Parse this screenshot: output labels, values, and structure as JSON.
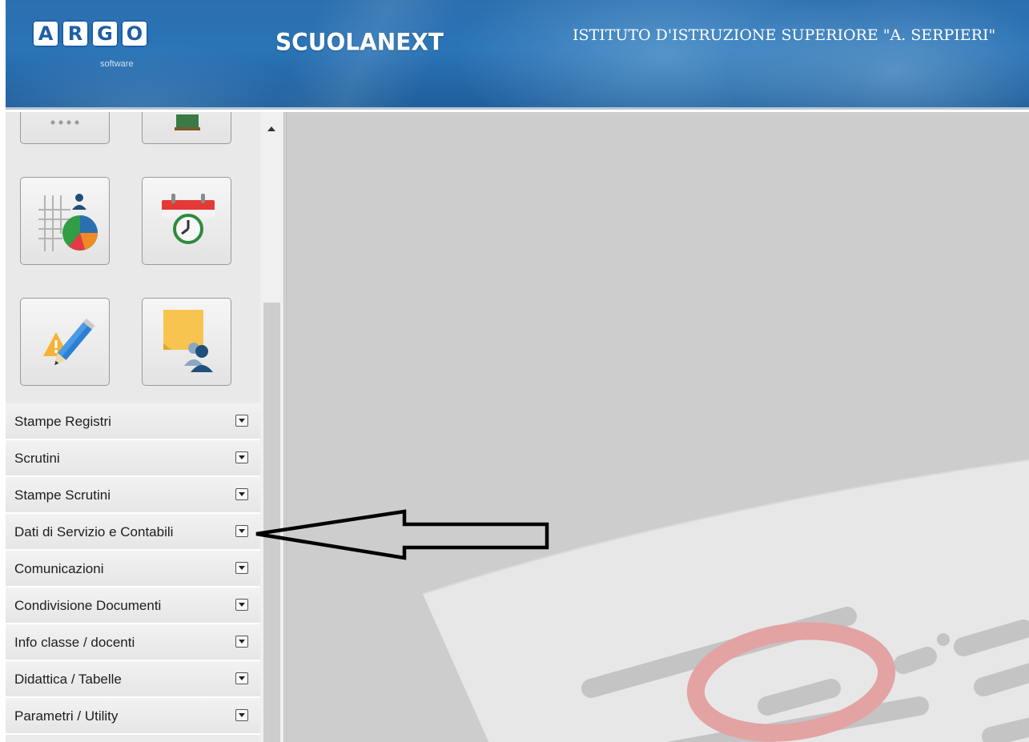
{
  "header": {
    "logo_letters": [
      "A",
      "R",
      "G",
      "O"
    ],
    "logo_subtitle": "software",
    "app_name": "SCUOLANEXT",
    "school_name": "ISTITUTO D'ISTRUZIONE SUPERIORE \"A. SERPIERI\""
  },
  "sidebar": {
    "icon_tiles": [
      {
        "icon": "grid-icon-partial"
      },
      {
        "icon": "board-icon-partial"
      },
      {
        "icon": "statistics-pie-chart-icon"
      },
      {
        "icon": "calendar-clock-icon"
      },
      {
        "icon": "warning-pencil-icon"
      },
      {
        "icon": "sticky-note-users-icon"
      }
    ],
    "menu": [
      {
        "label": "Stampe Registri"
      },
      {
        "label": "Scrutini"
      },
      {
        "label": "Stampe Scrutini"
      },
      {
        "label": "Dati di Servizio e Contabili"
      },
      {
        "label": "Comunicazioni"
      },
      {
        "label": "Condivisione Documenti"
      },
      {
        "label": "Info classe / docenti"
      },
      {
        "label": "Didattica / Tabelle"
      },
      {
        "label": "Parametri / Utility"
      }
    ]
  },
  "colors": {
    "header_blue": "#2a74b6",
    "content_gray": "#cdcdcd",
    "watermark_red": "#e3a3a3"
  }
}
